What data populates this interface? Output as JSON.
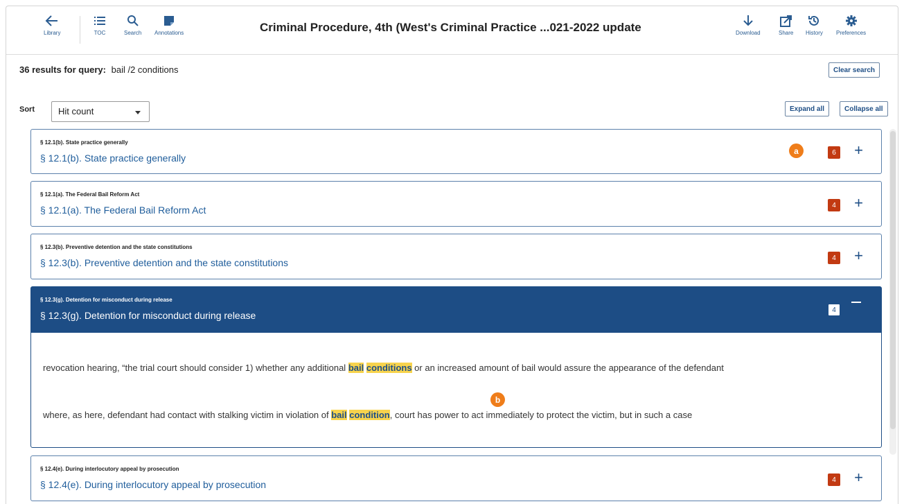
{
  "toolbar": {
    "library": "Library",
    "toc": "TOC",
    "search": "Search",
    "annotations": "Annotations",
    "title": "Criminal Procedure, 4th (West's Criminal Practice ...021-2022 update",
    "download": "Download",
    "share": "Share",
    "history": "History",
    "preferences": "Preferences"
  },
  "query": {
    "count": "36 results for query:",
    "text": "bail /2 conditions",
    "clear": "Clear search"
  },
  "sort": {
    "label": "Sort",
    "selected": "Hit count"
  },
  "controls": {
    "expand": "Expand all",
    "collapse": "Collapse all"
  },
  "results": [
    {
      "small": "§ 12.1(b). State practice generally",
      "title": "§ 12.1(b). State practice generally",
      "hits": "6"
    },
    {
      "small": "§ 12.1(a). The Federal Bail Reform Act",
      "title": "§ 12.1(a). The Federal Bail Reform Act",
      "hits": "4"
    },
    {
      "small": "§ 12.3(b). Preventive detention and the state constitutions",
      "title": "§ 12.3(b). Preventive detention and the state constitutions",
      "hits": "4"
    },
    {
      "small": "§ 12.3(g). Detention for misconduct during release",
      "title": "§ 12.3(g). Detention for misconduct during release",
      "hits": "4",
      "snippets": [
        {
          "before": "revocation hearing, “the trial court should consider 1) whether any additional ",
          "h1": "bail",
          "h2": "conditions",
          "after": " or an increased amount of bail would assure the appearance of the defendant"
        },
        {
          "before": "where, as here, defendant had contact with stalking victim in violation of ",
          "h1": "bail",
          "h2": "condition",
          "after": ", court has power to act immediately to protect the victim, but in such a case"
        }
      ]
    },
    {
      "small": "§ 12.4(e). During interlocutory appeal by prosecution",
      "title": "§ 12.4(e). During interlocutory appeal by prosecution",
      "hits": "4"
    }
  ],
  "callouts": {
    "a": "a",
    "b": "b"
  },
  "colors": {
    "accent": "#1d4d85",
    "badge": "#c23a12",
    "highlight": "#f7d34d",
    "callout": "#ef7d1a"
  },
  "icons": [
    "arrow-left-icon",
    "list-icon",
    "search-icon",
    "annotation-icon",
    "download-icon",
    "share-icon",
    "history-icon",
    "gear-icon"
  ]
}
